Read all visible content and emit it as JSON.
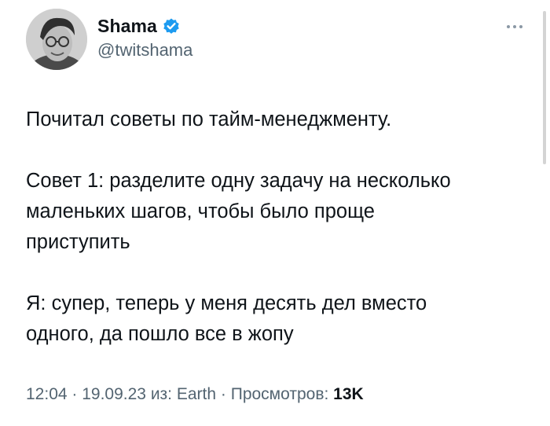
{
  "author": {
    "display_name": "Shama",
    "handle": "@twitshama",
    "verified": true,
    "avatar_icon": "user-avatar-photo"
  },
  "tweet": {
    "lines": [
      "Почитал советы по тайм-менеджменту.",
      "",
      "Совет 1: разделите одну задачу на несколько",
      "маленьких шагов, чтобы было проще",
      "приступить",
      "",
      "Я: супер, теперь у меня десять дел вместо",
      "одного, да пошло все в жопу"
    ]
  },
  "meta": {
    "time": "12:04",
    "sep1": " · ",
    "date": "19.09.23",
    "source_prefix": " из: ",
    "source": "Earth",
    "sep2": " · ",
    "views_label": "Просмотров: ",
    "views_count": "13K"
  },
  "colors": {
    "verified_badge": "#1d9bf0",
    "secondary_text": "#536471",
    "primary_text": "#0f1419"
  },
  "icons": {
    "more": "more-options-icon",
    "verified": "verified-badge-icon"
  }
}
